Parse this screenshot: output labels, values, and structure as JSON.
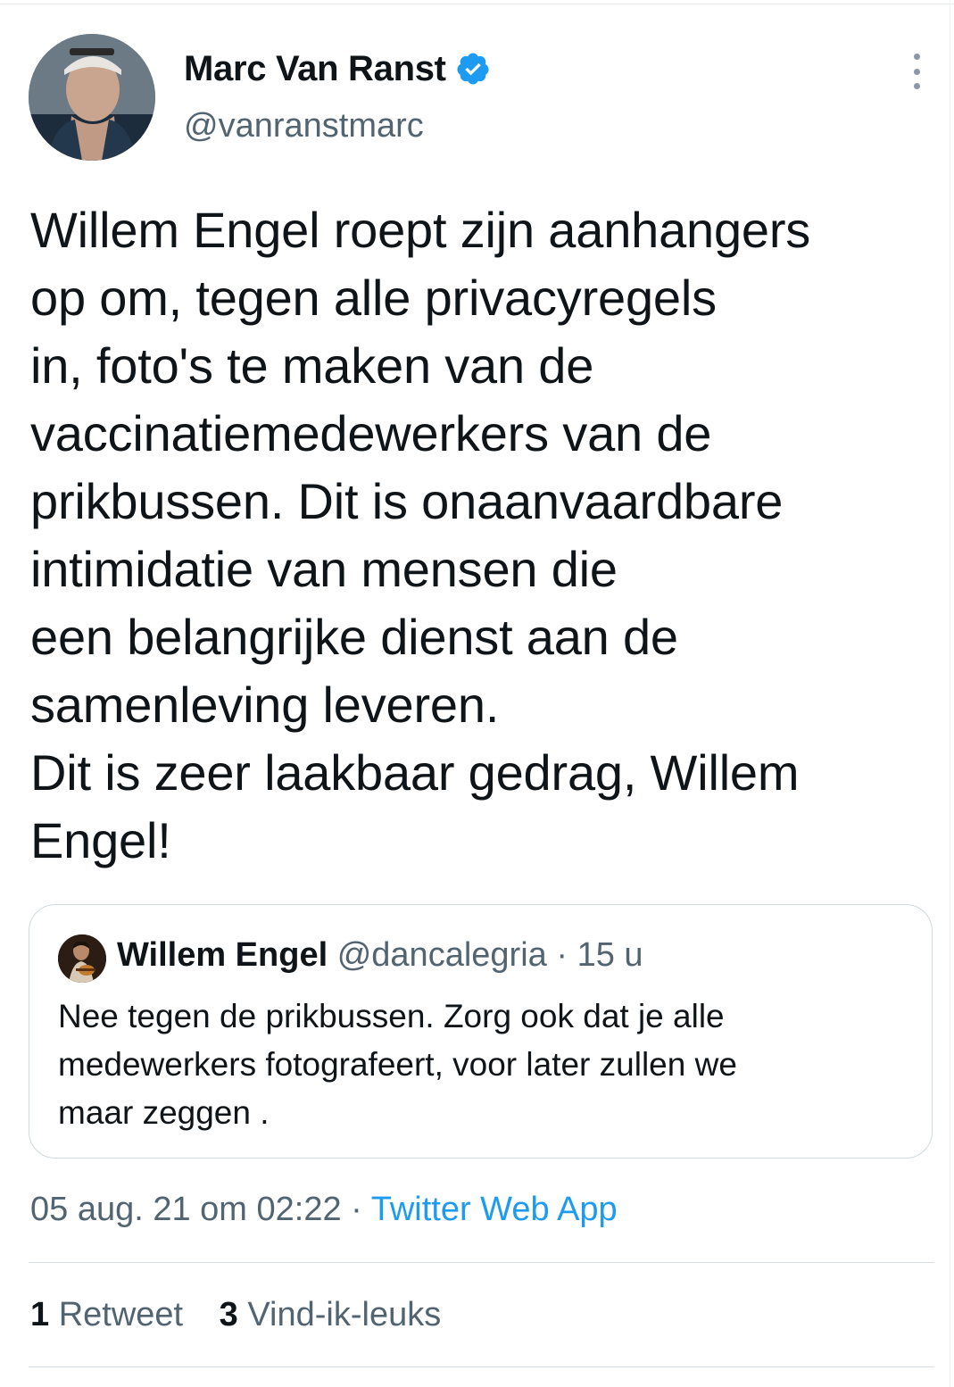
{
  "author": {
    "name": "Marc Van Ranst",
    "handle": "@vanranstmarc",
    "verified": true
  },
  "tweet": {
    "lines": [
      "Willem Engel roept zijn aanhangers",
      "op om, tegen alle privacyregels",
      "in, foto's te maken van de",
      "vaccinatiemedewerkers van de",
      "prikbussen. Dit is onaanvaardbare",
      "intimidatie van mensen die",
      "een belangrijke dienst aan de",
      "samenleving leveren.",
      "Dit is zeer laakbaar gedrag, Willem",
      "Engel!"
    ]
  },
  "quote": {
    "name": "Willem Engel",
    "handle": "@dancalegria",
    "separator": "·",
    "time": "15 u",
    "lines": [
      "Nee tegen de prikbussen. Zorg ook dat je alle",
      "medewerkers fotografeert, voor later zullen we",
      "maar zeggen ."
    ]
  },
  "meta": {
    "date": "05 aug. 21 om 02:22",
    "separator": "·",
    "source": "Twitter Web App"
  },
  "stats": {
    "retweets_count": "1",
    "retweets_label": "Retweet",
    "likes_count": "3",
    "likes_label": "Vind-ik-leuks"
  },
  "colors": {
    "text": "#0f1419",
    "secondary": "#536471",
    "link": "#1d9bf0",
    "border": "#cfd9de"
  },
  "icons": {
    "verified": "verified-badge-icon",
    "more": "more-vertical-icon"
  }
}
